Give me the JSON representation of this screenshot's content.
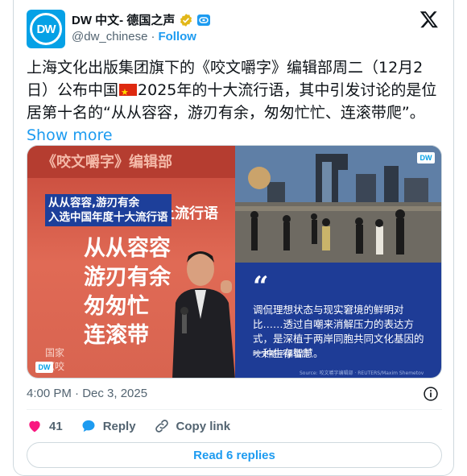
{
  "account": {
    "display_name": "DW 中文- 德国之声",
    "handle": "@dw_chinese",
    "separator": "·",
    "follow_label": "Follow",
    "avatar_text": "DW"
  },
  "tweet": {
    "text_part1": "上海文化出版集团旗下的《咬文嚼字》编辑部周二（12月2日）公布中国",
    "text_part2": "2025年的十大流行语，其中引发讨论的是位居第十名的“从从容容，游刃有余，匆匆忙忙、连滚带爬”。",
    "show_more_label": "Show more"
  },
  "media": {
    "left": {
      "book_title": "《咬文嚼字》编辑部",
      "caption_line1": "从从容容,游刃有余",
      "caption_line2": "入选中国年度十大流行语",
      "tag": "上流行语",
      "big_words": [
        "从从容容",
        "游刃有余",
        "匆匆忙",
        "连滚带"
      ],
      "small_words": [
        "国家",
        "《咬"
      ],
      "watermark": "DW"
    },
    "right": {
      "watermark": "DW",
      "quote_mark": "“",
      "quote_text": "调侃理想状态与现实窘境的鲜明对比……透过自嘲来消解压力的表达方式，是深植于两岸同胞共同文化基因的一种生存智慧。",
      "quote_source": "咬文嚼字编辑部",
      "source_tiny": "Source: 咬文嚼字编辑部 · REUTERS/Maxim Shemetov"
    }
  },
  "meta": {
    "timestamp": "4:00 PM · Dec 3, 2025"
  },
  "actions": {
    "like_count": "41",
    "reply_label": "Reply",
    "copy_label": "Copy link"
  },
  "read_replies_label": "Read 6 replies",
  "colors": {
    "accent": "#1d9bf0",
    "like": "#f91880",
    "dw_blue": "#05a1e6",
    "card_blue": "#1e3c96"
  }
}
